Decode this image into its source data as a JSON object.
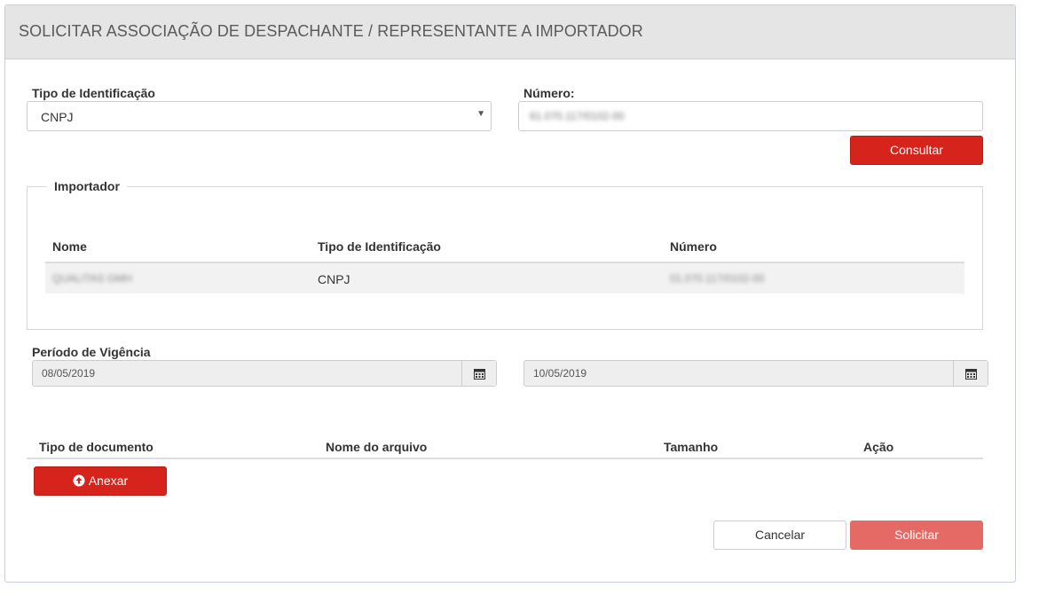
{
  "header": {
    "title": "SOLICITAR ASSOCIAÇÃO DE DESPACHANTE / REPRESENTANTE A IMPORTADOR"
  },
  "form": {
    "tipo_label": "Tipo de Identificação",
    "tipo_value": "CNPJ",
    "numero_label": "Número:",
    "numero_value": "61.070.117/0102-00",
    "consultar_label": "Consultar"
  },
  "importador": {
    "legend": "Importador",
    "columns": [
      "Nome",
      "Tipo de Identificação",
      "Número"
    ],
    "rows": [
      {
        "nome": "QUALITAS GMH",
        "tipo": "CNPJ",
        "numero": "01.070.117/0102-00"
      }
    ]
  },
  "vigencia": {
    "label": "Período de Vigência",
    "start": "08/05/2019",
    "end": "10/05/2019"
  },
  "documentos": {
    "columns": [
      "Tipo de documento",
      "Nome do arquivo",
      "Tamanho",
      "Ação"
    ],
    "anexar_label": "Anexar"
  },
  "actions": {
    "cancel_label": "Cancelar",
    "submit_label": "Solicitar"
  },
  "colors": {
    "primary_red": "#d6231b",
    "disabled_red": "#e56a66",
    "header_bg": "#e5e5e5"
  },
  "icons": {
    "caret": "caret-down-icon",
    "calendar": "calendar-icon",
    "upload": "upload-circle-icon"
  }
}
